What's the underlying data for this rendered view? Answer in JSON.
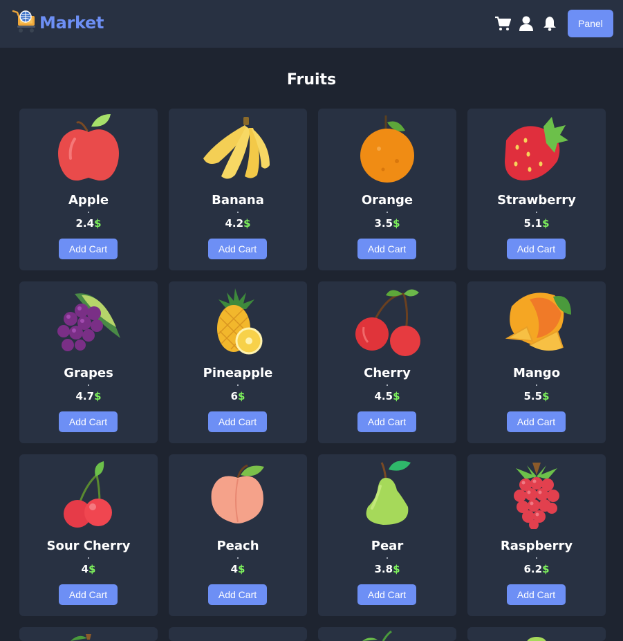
{
  "app": {
    "title": "Market"
  },
  "header": {
    "panel_label": "Panel",
    "icons": [
      "cart-icon",
      "user-icon",
      "bell-icon"
    ]
  },
  "page": {
    "title": "Fruits"
  },
  "colors": {
    "accent": "#6d8ff5",
    "currency": "#7ef25c",
    "card": "#283142",
    "bg": "#1e2430"
  },
  "products": [
    {
      "name": "Apple",
      "price": "2.4",
      "currency": "$",
      "action": "Add Cart",
      "icon": "apple-icon"
    },
    {
      "name": "Banana",
      "price": "4.2",
      "currency": "$",
      "action": "Add Cart",
      "icon": "banana-icon"
    },
    {
      "name": "Orange",
      "price": "3.5",
      "currency": "$",
      "action": "Add Cart",
      "icon": "orange-icon"
    },
    {
      "name": "Strawberry",
      "price": "5.1",
      "currency": "$",
      "action": "Add Cart",
      "icon": "strawberry-icon"
    },
    {
      "name": "Grapes",
      "price": "4.7",
      "currency": "$",
      "action": "Add Cart",
      "icon": "grapes-icon"
    },
    {
      "name": "Pineapple",
      "price": "6",
      "currency": "$",
      "action": "Add Cart",
      "icon": "pineapple-icon"
    },
    {
      "name": "Cherry",
      "price": "4.5",
      "currency": "$",
      "action": "Add Cart",
      "icon": "cherry-icon"
    },
    {
      "name": "Mango",
      "price": "5.5",
      "currency": "$",
      "action": "Add Cart",
      "icon": "mango-icon"
    },
    {
      "name": "Sour Cherry",
      "price": "4",
      "currency": "$",
      "action": "Add Cart",
      "icon": "sour-cherry-icon"
    },
    {
      "name": "Peach",
      "price": "4",
      "currency": "$",
      "action": "Add Cart",
      "icon": "peach-icon"
    },
    {
      "name": "Pear",
      "price": "3.8",
      "currency": "$",
      "action": "Add Cart",
      "icon": "pear-icon"
    },
    {
      "name": "Raspberry",
      "price": "6.2",
      "currency": "$",
      "action": "Add Cart",
      "icon": "raspberry-icon"
    }
  ]
}
